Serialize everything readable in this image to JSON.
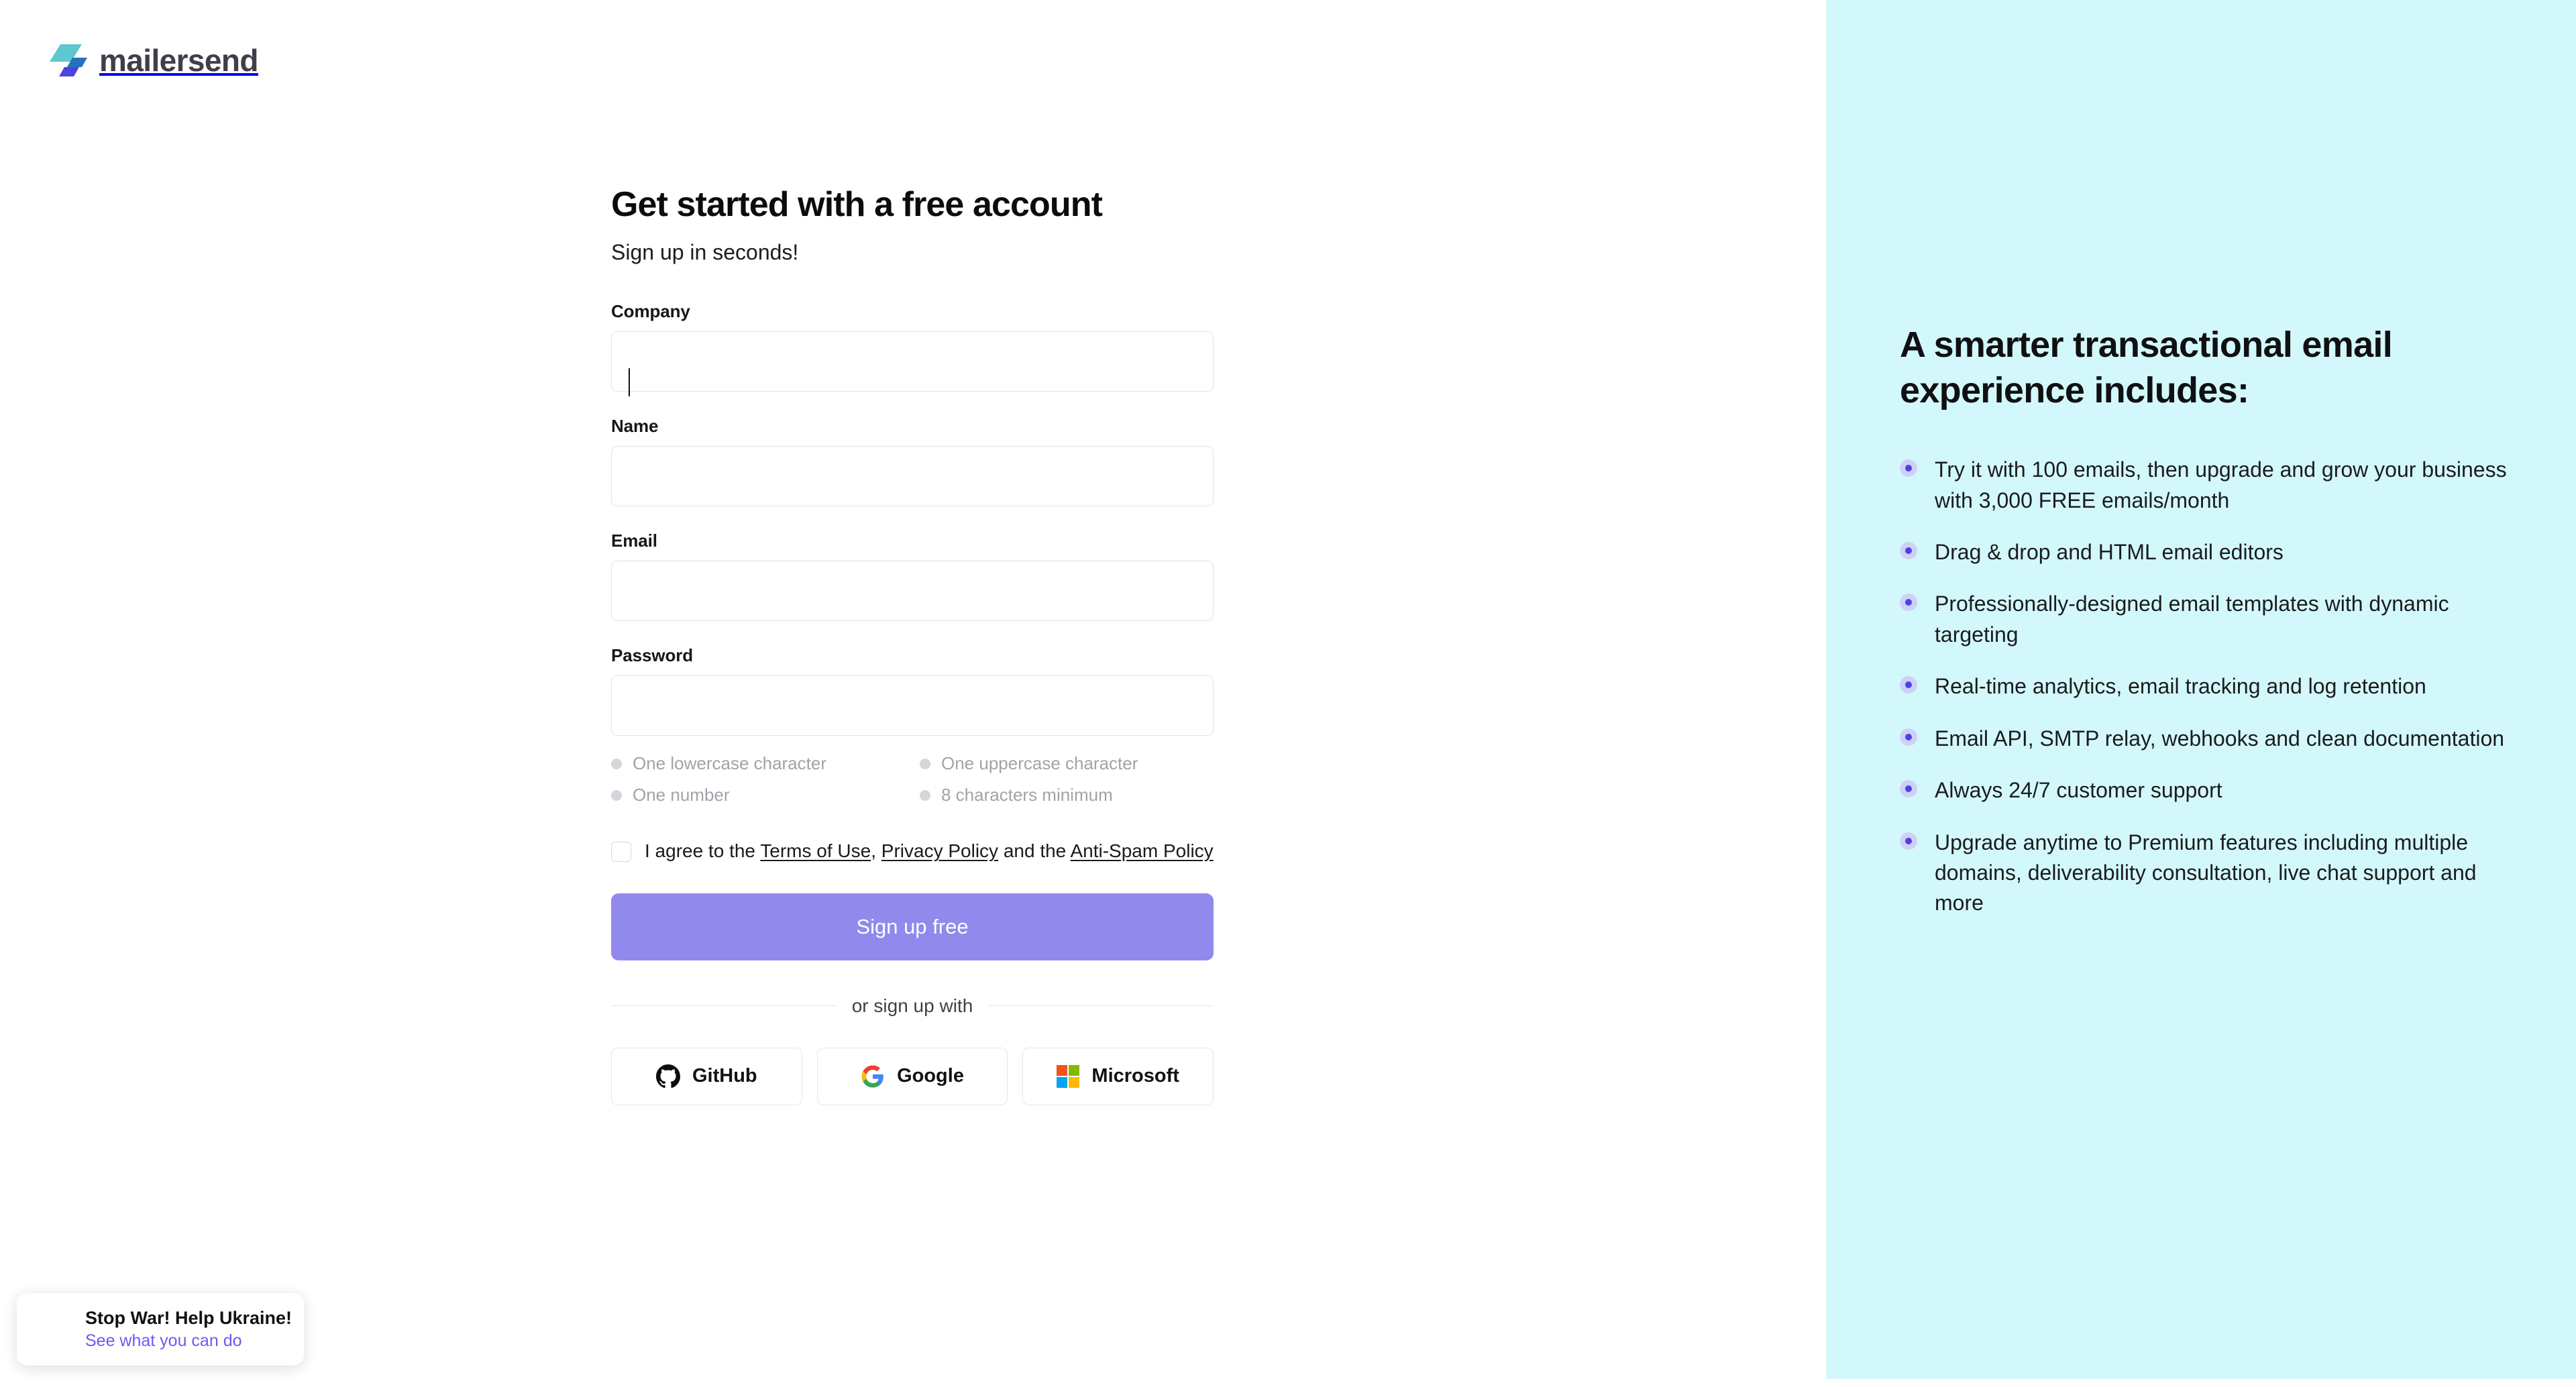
{
  "brand": {
    "name": "mailersend",
    "logo_icon": "mailersend-bolt-icon",
    "colors": {
      "logo_teal": "#5ec7cf",
      "logo_blue": "#2372bc",
      "logo_indigo": "#4b45dd",
      "accent_purple": "#9189ec",
      "promo_background": "#d3f8fb",
      "link_purple": "#6b5bf0"
    }
  },
  "signup": {
    "title": "Get started with a free account",
    "subtitle": "Sign up in seconds!",
    "fields": [
      {
        "label": "Company",
        "value": "",
        "placeholder": "",
        "focused": true,
        "type": "text"
      },
      {
        "label": "Name",
        "value": "",
        "placeholder": "",
        "focused": false,
        "type": "text"
      },
      {
        "label": "Email",
        "value": "",
        "placeholder": "",
        "focused": false,
        "type": "email"
      },
      {
        "label": "Password",
        "value": "",
        "placeholder": "",
        "focused": false,
        "type": "password"
      }
    ],
    "password_rules": [
      "One lowercase character",
      "One uppercase character",
      "One number",
      "8 characters minimum"
    ],
    "terms": {
      "checked": false,
      "prefix": "I agree to the ",
      "link1": "Terms of Use",
      "sep1": ", ",
      "link2": "Privacy Policy",
      "sep2": " and the ",
      "link3": "Anti-Spam Policy"
    },
    "submit_label": "Sign up free",
    "divider_label": "or sign up with",
    "social_buttons": [
      {
        "label": "GitHub",
        "icon": "github-icon"
      },
      {
        "label": "Google",
        "icon": "google-icon"
      },
      {
        "label": "Microsoft",
        "icon": "microsoft-icon"
      }
    ]
  },
  "promo": {
    "heading": "A smarter transactional email experience includes:",
    "items": [
      "Try it with 100 emails, then upgrade and grow your business with 3,000 FREE emails/month",
      "Drag & drop and HTML email editors",
      "Professionally-designed email templates with dynamic targeting",
      "Real-time analytics, email tracking and log retention",
      "Email API, SMTP relay, webhooks and clean documentation",
      "Always 24/7 customer support",
      "Upgrade anytime to Premium features including multiple domains, deliverability consultation, live chat support and more"
    ]
  },
  "ukraine_banner": {
    "title": "Stop War! Help Ukraine!",
    "link": "See what you can do",
    "flag_icon": "ukraine-flag-icon"
  }
}
